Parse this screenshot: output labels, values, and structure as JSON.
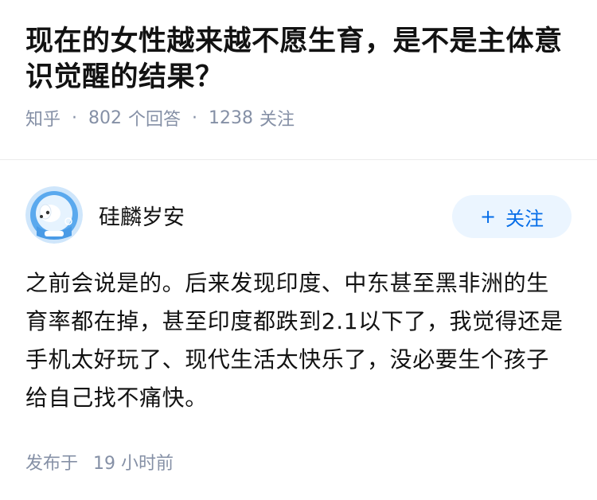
{
  "question": {
    "title": "现在的女性越来越不愿生育，是不是主体意识觉醒的结果？",
    "source": "知乎",
    "answers_count": "802",
    "answers_label": "个回答",
    "follows_count": "1238",
    "follows_label": "关注"
  },
  "author": {
    "name": "硅麟岁安",
    "avatar_icon": "astronaut-dog-avatar-icon",
    "follow_label": "关注"
  },
  "answer": {
    "text": "之前会说是的。后来发现印度、中东甚至黑非洲的生育率都在掉，甚至印度都跌到2.1以下了，我觉得还是手机太好玩了、现代生活太快乐了，没必要生个孩子给自己找不痛快。"
  },
  "footer": {
    "published_label": "发布于",
    "published_time": "19 小时前"
  },
  "colors": {
    "accent": "#056de8",
    "accent_bg": "#ebf5ff",
    "meta": "#8590a6"
  }
}
